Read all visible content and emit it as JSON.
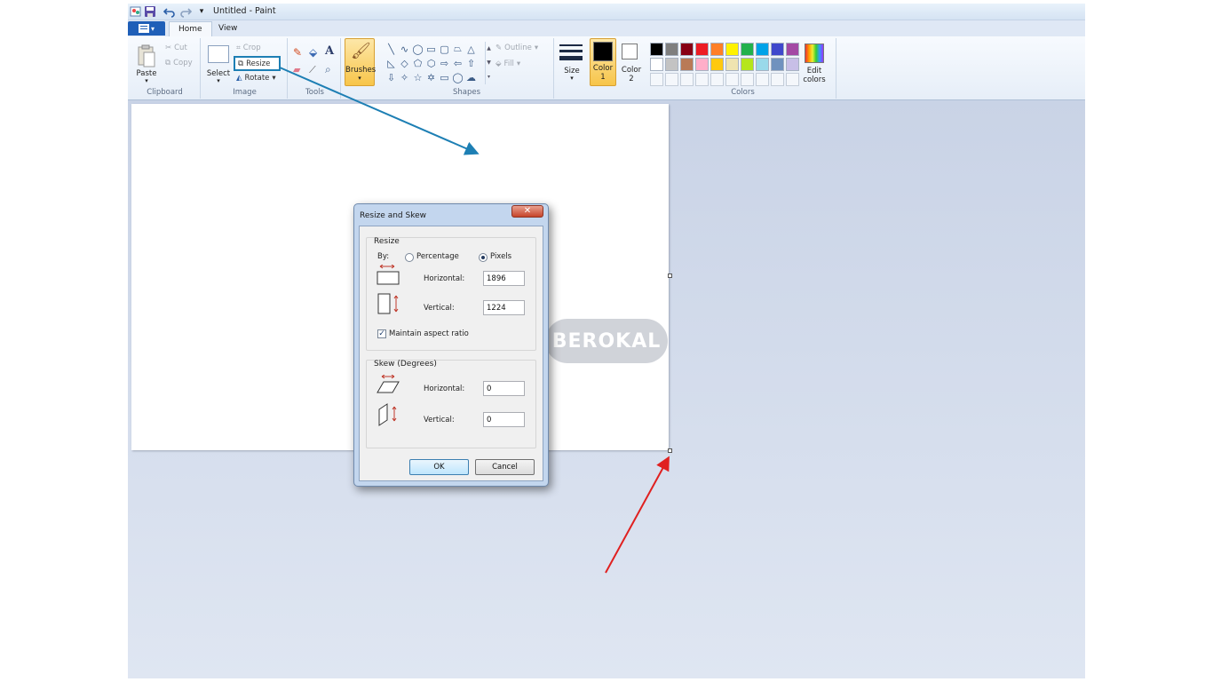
{
  "window": {
    "title": "Untitled - Paint"
  },
  "tabs": {
    "home": "Home",
    "view": "View"
  },
  "clipboard": {
    "paste": "Paste",
    "cut": "Cut",
    "copy": "Copy",
    "group": "Clipboard"
  },
  "image": {
    "select": "Select",
    "crop": "Crop",
    "resize": "Resize",
    "rotate": "Rotate",
    "group": "Image"
  },
  "tools": {
    "group": "Tools",
    "text_tool": "A"
  },
  "brushes": {
    "label": "Brushes"
  },
  "shapes": {
    "outline": "Outline",
    "fill": "Fill",
    "group": "Shapes"
  },
  "size": {
    "label": "Size"
  },
  "color1": {
    "label": "Color",
    "num": "1",
    "value": "#000000"
  },
  "color2": {
    "label": "Color",
    "num": "2",
    "value": "#ffffff"
  },
  "colors": {
    "group": "Colors",
    "edit": "Edit colors",
    "swatches": [
      "#000000",
      "#7f7f7f",
      "#880015",
      "#ed1c24",
      "#ff7f27",
      "#fff200",
      "#22b14c",
      "#00a2e8",
      "#3f48cc",
      "#a349a4",
      "#ffffff",
      "#c3c3c3",
      "#b97a57",
      "#ffaec9",
      "#ffc90e",
      "#efe4b0",
      "#b5e61d",
      "#99d9ea",
      "#7092be",
      "#c8bfe7"
    ]
  },
  "watermark": "BEROKAL",
  "dialog": {
    "title": "Resize and Skew",
    "close": "✕",
    "resize_legend": "Resize",
    "by": "By:",
    "percentage": "Percentage",
    "pixels": "Pixels",
    "horizontal": "Horizontal:",
    "vertical": "Vertical:",
    "resize_horizontal_value": "1896",
    "resize_vertical_value": "1224",
    "maintain_aspect": "Maintain aspect ratio",
    "skew_legend": "Skew (Degrees)",
    "skew_horizontal_value": "0",
    "skew_vertical_value": "0",
    "ok": "OK",
    "cancel": "Cancel"
  }
}
